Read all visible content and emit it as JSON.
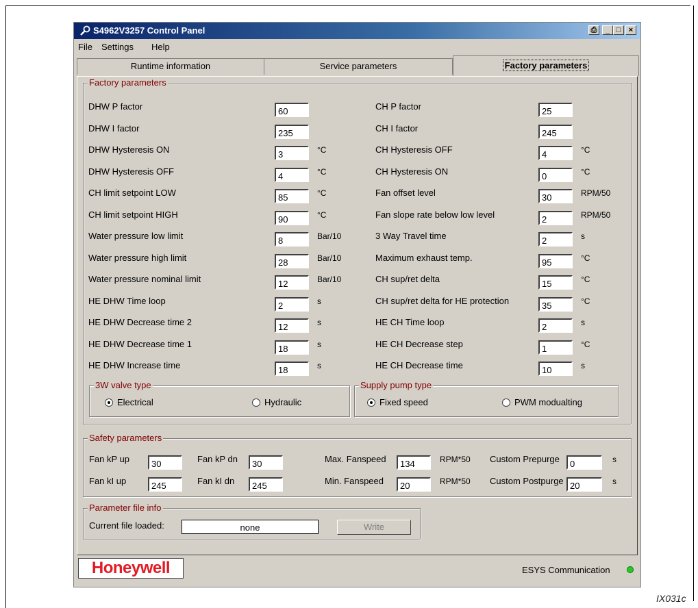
{
  "window": {
    "title": "S4962V3257 Control Panel"
  },
  "menu": [
    "File",
    "Settings",
    "Help"
  ],
  "tabs": [
    "Runtime information",
    "Service parameters",
    "Factory parameters"
  ],
  "factory": {
    "legend": "Factory parameters",
    "left": [
      {
        "label": "DHW P factor",
        "value": "60",
        "unit": ""
      },
      {
        "label": "DHW I factor",
        "value": "235",
        "unit": ""
      },
      {
        "label": "DHW Hysteresis ON",
        "value": "3",
        "unit": "°C"
      },
      {
        "label": "DHW Hysteresis OFF",
        "value": "4",
        "unit": "°C"
      },
      {
        "label": "CH limit setpoint LOW",
        "value": "85",
        "unit": "°C"
      },
      {
        "label": "CH limit setpoint HIGH",
        "value": "90",
        "unit": "°C"
      },
      {
        "label": "Water pressure low limit",
        "value": "8",
        "unit": "Bar/10"
      },
      {
        "label": "Water pressure high limit",
        "value": "28",
        "unit": "Bar/10"
      },
      {
        "label": "Water pressure nominal limit",
        "value": "12",
        "unit": "Bar/10"
      },
      {
        "label": "HE DHW Time loop",
        "value": "2",
        "unit": "s"
      },
      {
        "label": "HE DHW Decrease time 2",
        "value": "12",
        "unit": "s"
      },
      {
        "label": "HE DHW Decrease time 1",
        "value": "18",
        "unit": "s"
      },
      {
        "label": "HE DHW Increase time",
        "value": "18",
        "unit": "s"
      }
    ],
    "right": [
      {
        "label": "CH P factor",
        "value": "25",
        "unit": ""
      },
      {
        "label": "CH I factor",
        "value": "245",
        "unit": ""
      },
      {
        "label": "CH Hysteresis OFF",
        "value": "4",
        "unit": "°C"
      },
      {
        "label": "CH Hysteresis ON",
        "value": "0",
        "unit": "°C"
      },
      {
        "label": "Fan offset level",
        "value": "30",
        "unit": "RPM/50"
      },
      {
        "label": "Fan slope rate below low level",
        "value": "2",
        "unit": "RPM/50"
      },
      {
        "label": "3 Way Travel time",
        "value": "2",
        "unit": "s"
      },
      {
        "label": "Maximum exhaust temp.",
        "value": "95",
        "unit": "°C"
      },
      {
        "label": "CH sup/ret delta",
        "value": "15",
        "unit": "°C"
      },
      {
        "label": "CH sup/ret delta for HE protection",
        "value": "35",
        "unit": "°C"
      },
      {
        "label": "HE CH Time loop",
        "value": "2",
        "unit": "s"
      },
      {
        "label": "HE CH Decrease step",
        "value": "1",
        "unit": "°C"
      },
      {
        "label": "HE CH Decrease time",
        "value": "10",
        "unit": "s"
      }
    ],
    "valve": {
      "legend": "3W valve type",
      "options": [
        "Electrical",
        "Hydraulic"
      ],
      "selected": "Electrical"
    },
    "pump": {
      "legend": "Supply pump type",
      "options": [
        "Fixed speed",
        "PWM modualting"
      ],
      "selected": "Fixed speed"
    }
  },
  "safety": {
    "legend": "Safety parameters",
    "fan_kp_up": {
      "label": "Fan kP up",
      "value": "30"
    },
    "fan_kp_dn": {
      "label": "Fan kP dn",
      "value": "30"
    },
    "fan_ki_up": {
      "label": "Fan kI up",
      "value": "245"
    },
    "fan_ki_dn": {
      "label": "Fan kI dn",
      "value": "245"
    },
    "max_fanspeed": {
      "label": "Max. Fanspeed",
      "value": "134",
      "unit": "RPM*50"
    },
    "min_fanspeed": {
      "label": "Min. Fanspeed",
      "value": "20",
      "unit": "RPM*50"
    },
    "prepurge": {
      "label": "Custom Prepurge",
      "value": "0",
      "unit": "s"
    },
    "postpurge": {
      "label": "Custom Postpurge",
      "value": "20",
      "unit": "s"
    }
  },
  "file_info": {
    "legend": "Parameter file info",
    "label": "Current file loaded:",
    "value": "none",
    "write_label": "Write"
  },
  "status": {
    "brand": "Honeywell",
    "connection": "ESYS Communication",
    "led_color": "#22cc22"
  },
  "figure_code": "IX031c"
}
